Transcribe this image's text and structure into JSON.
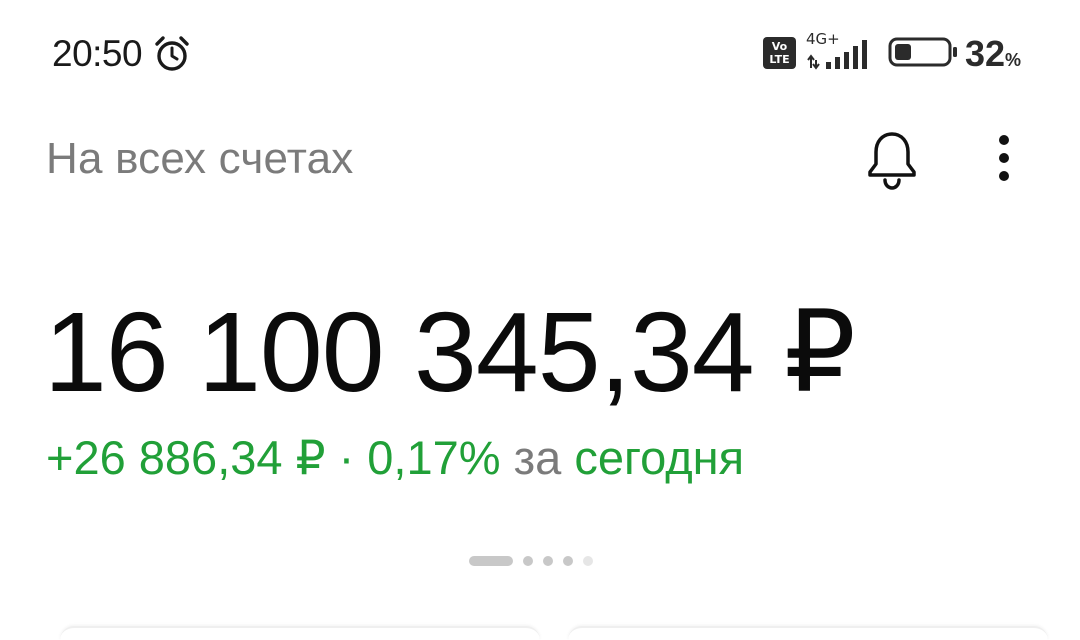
{
  "status_bar": {
    "time": "20:50",
    "volte_label_top": "Vo",
    "volte_label_bottom": "LTE",
    "network_type": "4G+",
    "battery_level": "32",
    "battery_unit": "%",
    "battery_fraction": 0.32
  },
  "header": {
    "title": "На всех счетах"
  },
  "balance": {
    "amount": "16 100 345,34 ₽"
  },
  "daily_change": {
    "amount": "+26 886,34 ₽",
    "separator": "·",
    "percent": "0,17%",
    "period_prefix": "за",
    "period": "сегодня"
  },
  "pager": {
    "count": 5,
    "active_index": 0
  },
  "colors": {
    "accent_green": "#21a038",
    "secondary_text": "#7b7b7b",
    "primary_text": "#0b0b0b"
  }
}
